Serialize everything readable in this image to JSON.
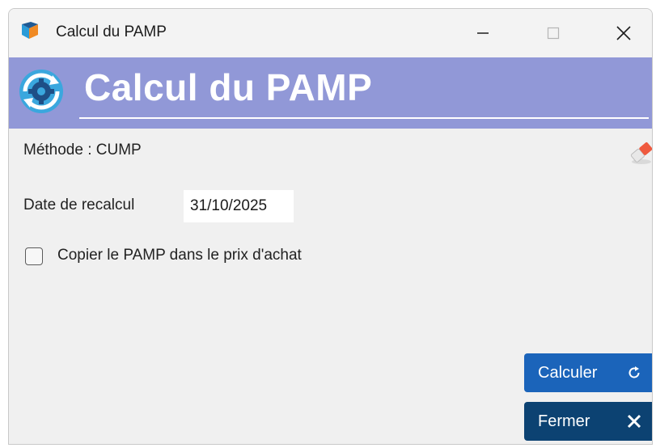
{
  "window": {
    "title": "Calcul du PAMP",
    "controls": {
      "minimize": "minimize-icon",
      "maximize": "maximize-icon",
      "close": "close-icon"
    }
  },
  "header": {
    "title": "Calcul du PAMP",
    "background": "#9198d7",
    "icon": "gear-refresh-icon"
  },
  "form": {
    "method_label": "Méthode : CUMP",
    "clear_icon": "eraser-icon",
    "date_label": "Date de recalcul",
    "date_value": "31/10/2025",
    "copy_label": "Copier le PAMP dans le prix d'achat",
    "copy_checked": false
  },
  "buttons": {
    "calculate": {
      "label": "Calculer",
      "icon": "refresh-icon",
      "color": "#1b64ba"
    },
    "close": {
      "label": "Fermer",
      "icon": "close-icon",
      "color": "#0c4272"
    }
  }
}
